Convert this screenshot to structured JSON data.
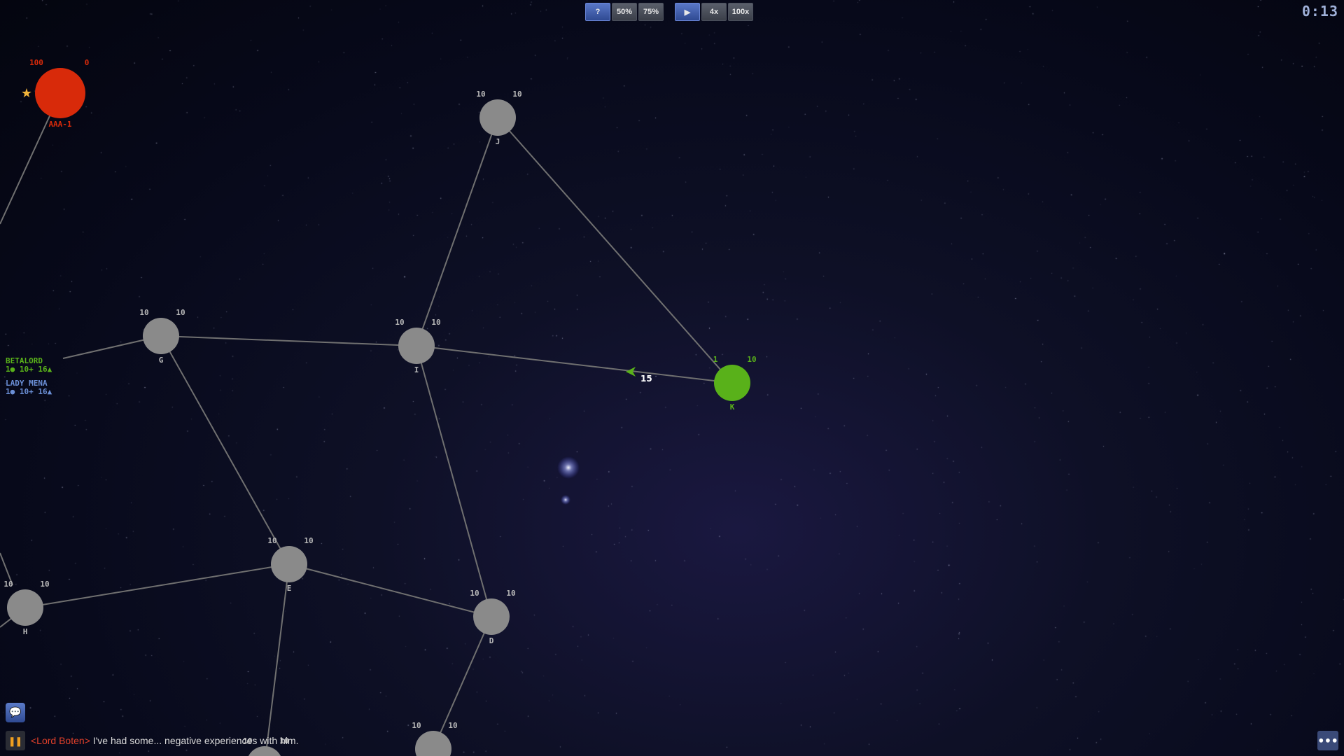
{
  "toolbar": {
    "help_label": "?",
    "zoom_buttons": [
      "50%",
      "75%"
    ],
    "play_icon": "play-icon",
    "speed_buttons": [
      "4x",
      "100x"
    ]
  },
  "timer": "0:13",
  "colors": {
    "enemy": "#d82a0a",
    "player": "#59b11a",
    "neutral": "#8a8a8a",
    "ally": "#6b8fd6",
    "link": "#707070"
  },
  "players": [
    {
      "name": "BETALORD",
      "stats": "1● 10+ 16▲",
      "color": "#59b11a"
    },
    {
      "name": "LADY MENA",
      "stats": "1● 10+ 16▲",
      "color": "#6b8fd6"
    }
  ],
  "planets": [
    {
      "id": "AAA-1",
      "label": "AAA-1",
      "owner": "enemy",
      "ships": "100",
      "production": "0",
      "home": true
    },
    {
      "id": "J",
      "label": "J",
      "owner": "neutral",
      "ships": "10",
      "production": "10"
    },
    {
      "id": "G",
      "label": "G",
      "owner": "neutral",
      "ships": "10",
      "production": "10"
    },
    {
      "id": "I",
      "label": "I",
      "owner": "neutral",
      "ships": "10",
      "production": "10"
    },
    {
      "id": "K",
      "label": "K",
      "owner": "player",
      "ships": "1",
      "production": "10"
    },
    {
      "id": "E",
      "label": "E",
      "owner": "neutral",
      "ships": "10",
      "production": "10"
    },
    {
      "id": "H",
      "label": "H",
      "owner": "neutral",
      "ships": "10",
      "production": "10"
    },
    {
      "id": "D",
      "label": "D",
      "owner": "neutral",
      "ships": "10",
      "production": "10"
    },
    {
      "id": "bottom-1",
      "label": "",
      "owner": "neutral",
      "ships": "10",
      "production": "10"
    },
    {
      "id": "bottom-2",
      "label": "",
      "owner": "neutral",
      "ships": "10",
      "production": "10"
    }
  ],
  "fleet": {
    "ships": "15",
    "from": "K",
    "to": "I"
  },
  "chat": {
    "speaker": "<Lord Boten>",
    "message": " I've had some... negative experiences with him."
  },
  "icons": {
    "chat": "chat-bubble-icon",
    "pause": "pause-icon",
    "menu": "more-icon",
    "home": "star-icon"
  }
}
